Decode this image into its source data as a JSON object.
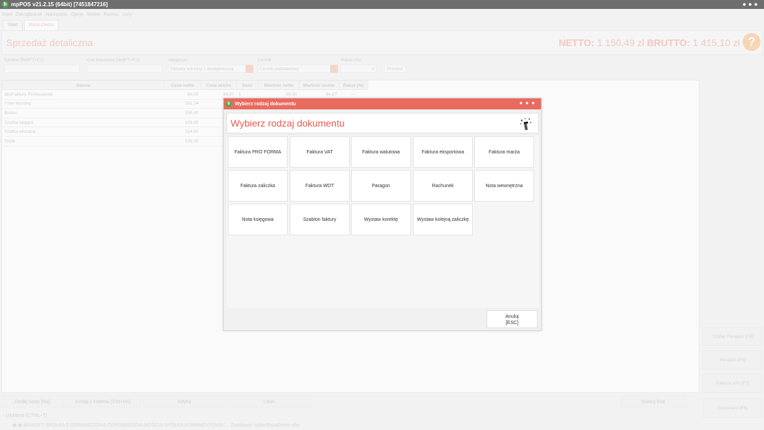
{
  "window": {
    "title": "mpPOS v21.2.15 (64bit) [7451847216]",
    "logo": "b"
  },
  "menu": [
    "Start",
    "Zarządzanie",
    "Narzędzia",
    "Opcje",
    "Widok",
    "Pomoc",
    "Listy"
  ],
  "tabs": [
    "Start",
    "Baza Demo"
  ],
  "header": {
    "title": "Sprzedaż detaliczna",
    "netto_label": "NETTO:",
    "netto_value": "1 150,49 zł",
    "brutto_label": "BRUTTO:",
    "brutto_value": "1 415,10 zł",
    "help_glyph": "?"
  },
  "filters": {
    "symbol_label": "Symbol [SHIFT+F1]:",
    "barcode_label": "Kod kreskowy [SHIFT+F2]:",
    "warehouse_label": "Magazyn:",
    "warehouse_value": "Główny lub inny z dostępnością",
    "pricelist_label": "Cennik:",
    "pricelist_value": "Cennik podstawowy",
    "discount_label": "Rabat (%):",
    "discount_value": "0",
    "recalc_label": "Przelicz"
  },
  "grid": {
    "columns": [
      "Nazwa",
      "Cena netto",
      "Cena brutto",
      "Ilość",
      "Wartość netto",
      "Wartość brutto",
      "Rabat (%)"
    ],
    "rows": [
      {
        "name": "absFaktury Professional",
        "net": "69,00",
        "gross": "84,87",
        "qty": "1",
        "val_net": "69,00",
        "val_gross": "84,87",
        "disc": "---"
      },
      {
        "name": "Fotel biurowy",
        "net": "511,34"
      },
      {
        "name": "Biurko",
        "net": "155,40"
      },
      {
        "name": "Szafka stojąca",
        "net": "103,95"
      },
      {
        "name": "Szafka wisząca",
        "net": "114,45"
      },
      {
        "name": "Stolik",
        "net": "196,35"
      }
    ]
  },
  "side_buttons": [
    "Szybki Paragon [F5]",
    "Paragon [F6]",
    "Faktura VAT [F7]",
    "Dokument [F8]"
  ],
  "bottom_buttons": [
    "Dodaj nowy [Ins]",
    "Dodaj z indeksu [Ctrl+Ins]",
    "Edytuj",
    "Usuń",
    "Drukuj listę"
  ],
  "favorites_label": "Ulubione [CTRL+T]",
  "status": "BINSOFT SPÓŁKA Z OGRANICZONĄ ODPOWIEDZIALNOŚCIĄ SPÓŁKA KOMANDYTOWA :... Database: sqlite:BazaDemo.dbx",
  "dialog": {
    "window_title": "Wybierz rodzaj dokumentu",
    "header_title": "Wybierz rodzaj dokumentu",
    "buttons": [
      "Faktura PRO FORMA",
      "Faktura VAT",
      "Faktura walutowa",
      "Faktura eksportowa",
      "Faktura marża",
      "Faktura zaliczka",
      "Faktura WDT",
      "Paragon",
      "Rachunek",
      "Nota wewnętrzna",
      "Nota księgowa",
      "Szablon faktury",
      "Wystaw korektę",
      "Wystaw kolejną zaliczkę"
    ],
    "cancel_label": "Anuluj",
    "cancel_shortcut": "[ESC]"
  },
  "colors": {
    "accent": "#e96b5f",
    "accent_text": "#e45c4f",
    "help": "#f8c895"
  }
}
